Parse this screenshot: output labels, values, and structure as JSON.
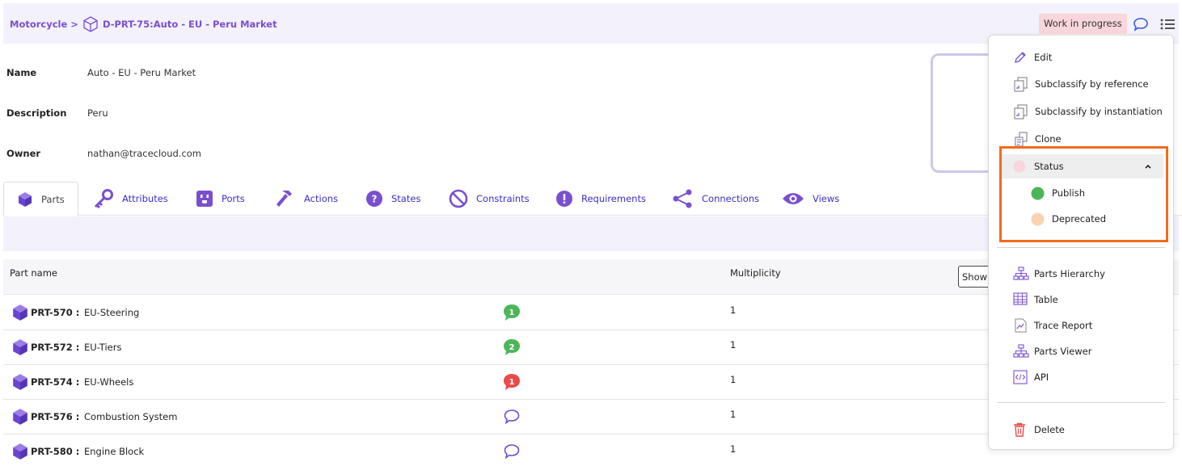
{
  "breadcrumb": {
    "parent": "Motorcycle >",
    "current": "D-PRT-75:Auto - EU - Peru Market"
  },
  "header": {
    "status_badge": "Work in progress"
  },
  "properties": [
    {
      "label": "Name",
      "value": "Auto - EU - Peru Market"
    },
    {
      "label": "Description",
      "value": "Peru"
    },
    {
      "label": "Owner",
      "value": "nathan@tracecloud.com"
    }
  ],
  "tabs": [
    {
      "label": "Parts",
      "icon": "cube-icon"
    },
    {
      "label": "Attributes",
      "icon": "key-icon"
    },
    {
      "label": "Ports",
      "icon": "port-icon"
    },
    {
      "label": "Actions",
      "icon": "hammer-icon"
    },
    {
      "label": "States",
      "icon": "question-icon"
    },
    {
      "label": "Constraints",
      "icon": "ban-icon"
    },
    {
      "label": "Requirements",
      "icon": "exclamation-icon"
    },
    {
      "label": "Connections",
      "icon": "share-nodes-icon"
    },
    {
      "label": "Views",
      "icon": "eye-icon"
    }
  ],
  "table": {
    "columns": {
      "part_name": "Part name",
      "multiplicity": "Multiplicity"
    },
    "show_button": "Show",
    "rows": [
      {
        "id": "PRT-570 :",
        "name": "EU-Steering",
        "comments": "1",
        "comment_color": "#4cb55a",
        "multiplicity": "1"
      },
      {
        "id": "PRT-572 :",
        "name": "EU-Tiers",
        "comments": "2",
        "comment_color": "#4cb55a",
        "multiplicity": "1"
      },
      {
        "id": "PRT-574 :",
        "name": "EU-Wheels",
        "comments": "1",
        "comment_color": "#e84b4b",
        "multiplicity": "1"
      },
      {
        "id": "PRT-576 :",
        "name": "Combustion System",
        "comments": "",
        "comment_color": "",
        "multiplicity": "1"
      },
      {
        "id": "PRT-580 :",
        "name": "Engine Block",
        "comments": "",
        "comment_color": "",
        "multiplicity": "1"
      }
    ]
  },
  "menu": {
    "edit": "Edit",
    "subclassify_reference": "Subclassify by reference",
    "subclassify_instantiation": "Subclassify by instantiation",
    "clone": "Clone",
    "status": "Status",
    "publish": "Publish",
    "deprecated": "Deprecated",
    "parts_hierarchy": "Parts Hierarchy",
    "table": "Table",
    "trace_report": "Trace Report",
    "parts_viewer": "Parts Viewer",
    "api": "API",
    "delete": "Delete"
  },
  "colors": {
    "accent": "#7a4fcf",
    "tab_text": "#3b2fc9",
    "highlight": "#f26b1d",
    "status_wip_bg": "#f9d6db",
    "publish": "#4cb55a",
    "deprecated": "#f9d3b1",
    "delete": "#e84b4b"
  }
}
